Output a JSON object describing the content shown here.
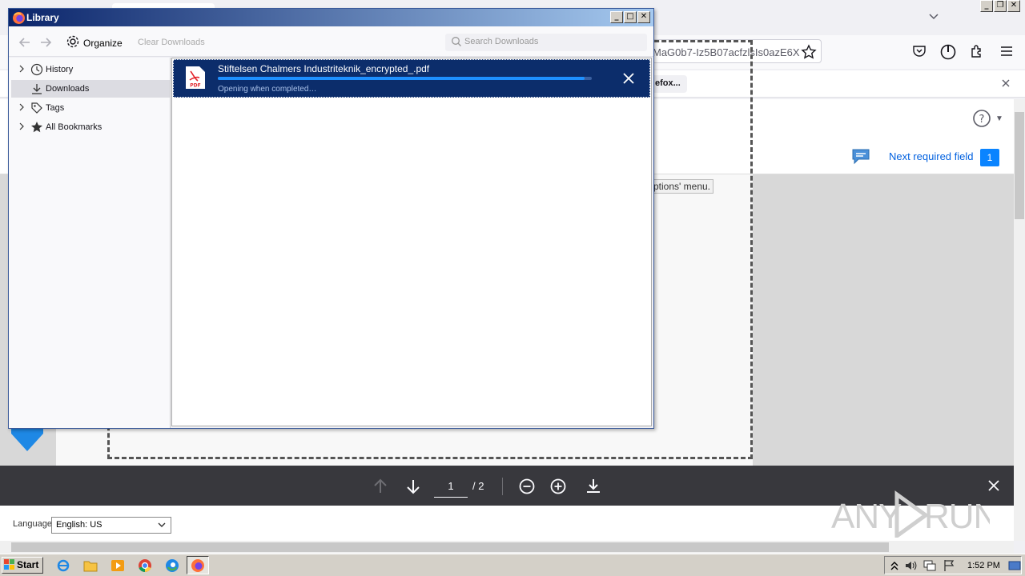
{
  "browser": {
    "url_fragment": "MaG0b7-Iz5B07acfzlsIs0azE6X",
    "notification_button": "efox...",
    "tooltip_fragment": "ptions' menu."
  },
  "pdf_viewer": {
    "next_field_label": "Next required field",
    "next_field_count": "1",
    "page_current": "1",
    "page_total": "/ 2",
    "language_label": "Language",
    "language_value": "English: US",
    "watermark": "ANY RUN"
  },
  "library": {
    "title": "Library",
    "organize_label": "Organize",
    "clear_label": "Clear Downloads",
    "search_placeholder": "Search Downloads",
    "tree": [
      {
        "label": "History",
        "icon": "clock-icon"
      },
      {
        "label": "Downloads",
        "icon": "download-icon"
      },
      {
        "label": "Tags",
        "icon": "tag-icon"
      },
      {
        "label": "All Bookmarks",
        "icon": "star-icon"
      }
    ],
    "download": {
      "filename": "Stiftelsen Chalmers Industriteknik_encrypted_.pdf",
      "status": "Opening when completed…",
      "progress": 0.98,
      "file_icon_text": "PDF"
    }
  },
  "taskbar": {
    "start_label": "Start",
    "clock": "1:52 PM"
  },
  "colors": {
    "selection_bg": "#0c2d6b",
    "accent": "#0a84ff",
    "pdf_toolbar": "#38383d"
  }
}
